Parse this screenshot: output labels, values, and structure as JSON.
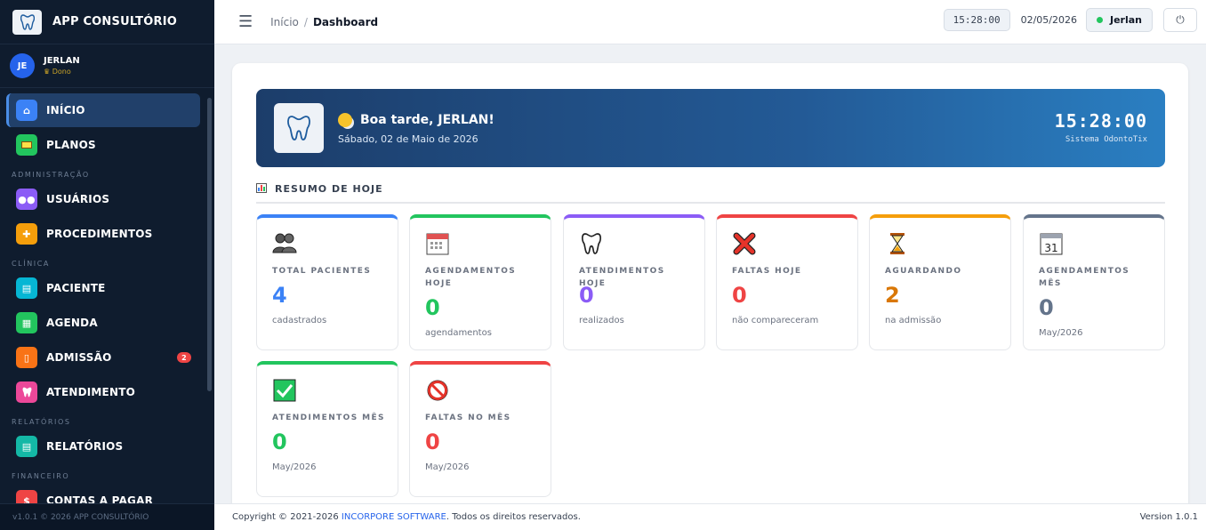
{
  "sidebar": {
    "brand": "APP CONSULTÓRIO",
    "user": {
      "initials": "JE",
      "name": "JERLAN",
      "role": "Dono"
    },
    "items": [
      {
        "label": "INÍCIO",
        "icon": "home-icon",
        "color": "#3b82f6",
        "active": true
      },
      {
        "label": "PLANOS",
        "icon": "card-icon",
        "color": "#22c55e"
      },
      {
        "label": "USUÁRIOS",
        "icon": "users-icon",
        "color": "#8b5cf6"
      },
      {
        "label": "PROCEDIMENTOS",
        "icon": "medkit-icon",
        "color": "#f59e0b"
      },
      {
        "label": "PACIENTE",
        "icon": "id-card-icon",
        "color": "#06b6d4"
      },
      {
        "label": "AGENDA",
        "icon": "calendar-icon",
        "color": "#22c55e"
      },
      {
        "label": "ADMISSÃO",
        "icon": "clipboard-icon",
        "color": "#f97316",
        "badge": "2"
      },
      {
        "label": "ATENDIMENTO",
        "icon": "tooth-icon",
        "color": "#ec4899"
      },
      {
        "label": "RELATÓRIOS",
        "icon": "file-icon",
        "color": "#14b8a6"
      },
      {
        "label": "CONTAS A PAGAR",
        "icon": "bill-icon",
        "color": "#ef4444"
      }
    ],
    "sections": {
      "admin": "ADMINISTRAÇÃO",
      "clinic": "CLÍNICA",
      "reports": "RELATÓRIOS",
      "finance": "FINANCEIRO"
    },
    "footer": "v1.0.1 © 2026 APP CONSULTÓRIO"
  },
  "topbar": {
    "breadcrumb": {
      "home": "Início",
      "separator": "/",
      "current": "Dashboard"
    },
    "time": "15:28:00",
    "date": "02/05/2026",
    "user": "Jerlan"
  },
  "hero": {
    "greeting": "Boa tarde, JERLAN!",
    "date": "Sábado, 02 de Maio de 2026",
    "clock": "15:28:00",
    "system": "Sistema OdontoTix"
  },
  "summary": {
    "title": "RESUMO DE HOJE",
    "cards": [
      {
        "label": "TOTAL PACIENTES",
        "value": "4",
        "sub": "cadastrados",
        "color": "#3b82f6",
        "icon": "patients-icon"
      },
      {
        "label": "AGENDAMENTOS HOJE",
        "value": "0",
        "sub": "agendamentos",
        "color": "#22c55e",
        "icon": "calendar-icon"
      },
      {
        "label": "ATENDIMENTOS HOJE",
        "value": "0",
        "sub": "realizados",
        "color": "#8b5cf6",
        "icon": "tooth-icon"
      },
      {
        "label": "FALTAS HOJE",
        "value": "0",
        "sub": "não compareceram",
        "color": "#ef4444",
        "icon": "cross-icon"
      },
      {
        "label": "AGUARDANDO",
        "value": "2",
        "sub": "na admissão",
        "color": "#f59e0b",
        "icon": "hourglass-icon"
      },
      {
        "label": "AGENDAMENTOS MÊS",
        "value": "0",
        "sub": "May/2026",
        "color": "#64748b",
        "icon": "calendar-31-icon"
      },
      {
        "label": "ATENDIMENTOS MÊS",
        "value": "0",
        "sub": "May/2026",
        "color": "#22c55e",
        "icon": "check-box-icon"
      },
      {
        "label": "FALTAS NO MÊS",
        "value": "0",
        "sub": "May/2026",
        "color": "#ef4444",
        "icon": "prohibited-icon"
      }
    ]
  },
  "footer": {
    "copyright_prefix": "Copyright © 2021-2026",
    "company": "INCORPORE SOFTWARE",
    "copyright_suffix": ". Todos os direitos reservados.",
    "version": "Version 1.0.1"
  }
}
